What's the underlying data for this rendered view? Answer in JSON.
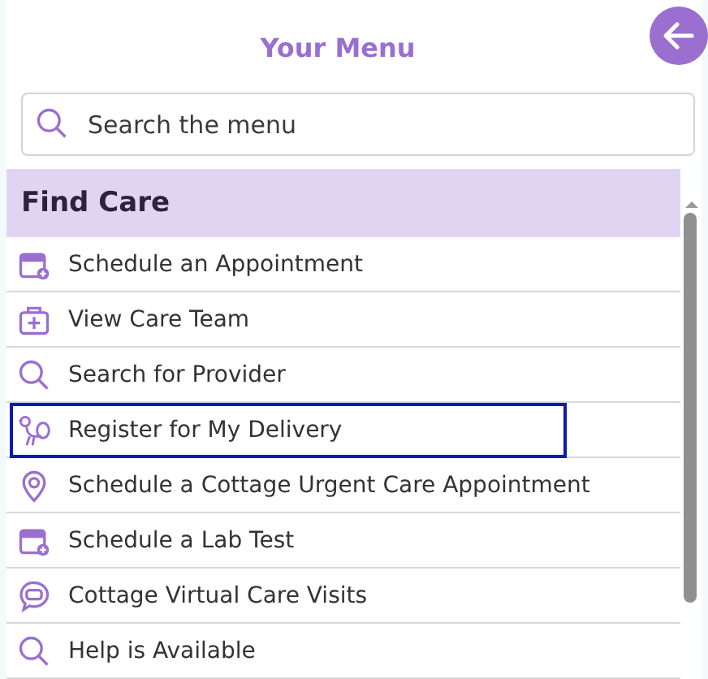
{
  "header": {
    "title": "Your Menu"
  },
  "search": {
    "placeholder": "Search the menu"
  },
  "section": {
    "title": "Find Care"
  },
  "items": [
    {
      "label": "Schedule an Appointment",
      "kind": "calendar",
      "selected": false
    },
    {
      "label": "View Care Team",
      "kind": "kit",
      "selected": false
    },
    {
      "label": "Search for Provider",
      "kind": "search",
      "selected": false
    },
    {
      "label": "Register for My Delivery",
      "kind": "bird",
      "selected": true
    },
    {
      "label": "Schedule a Cottage Urgent Care Appointment",
      "kind": "pin",
      "selected": false
    },
    {
      "label": "Schedule a Lab Test",
      "kind": "calendar",
      "selected": false
    },
    {
      "label": "Cottage Virtual Care Visits",
      "kind": "chat",
      "selected": false
    },
    {
      "label": "Help is Available",
      "kind": "search",
      "selected": false
    }
  ]
}
